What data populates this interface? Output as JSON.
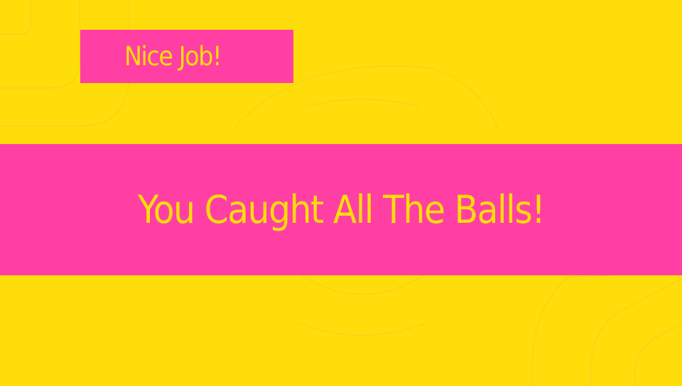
{
  "colors": {
    "background": "#FFDD0A",
    "accent": "#FF3FA4",
    "text": "#FFDD0A"
  },
  "badge": {
    "label": "Nice Job!"
  },
  "banner": {
    "message": "You Caught All The Balls!"
  }
}
